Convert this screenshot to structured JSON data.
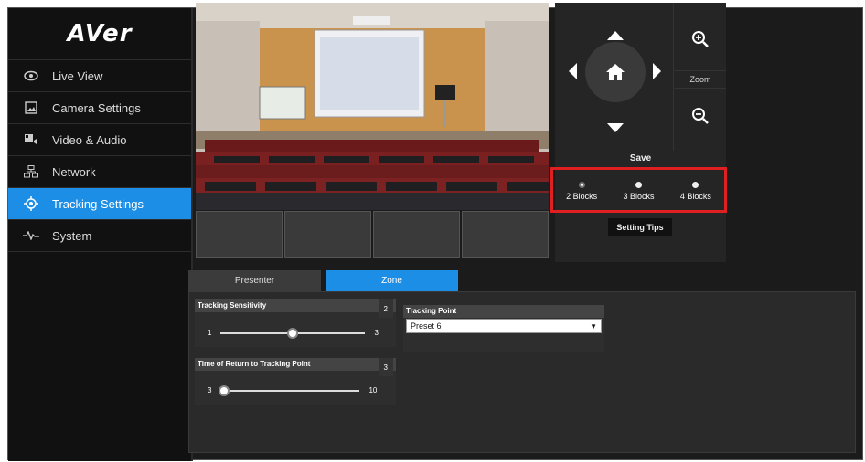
{
  "brand": {
    "logo_text": "AVer"
  },
  "sidebar": {
    "items": [
      {
        "label": "Live View",
        "icon": "eye-icon",
        "active": false
      },
      {
        "label": "Camera Settings",
        "icon": "image-icon",
        "active": false
      },
      {
        "label": "Video & Audio",
        "icon": "video-audio-icon",
        "active": false
      },
      {
        "label": "Network",
        "icon": "network-icon",
        "active": false
      },
      {
        "label": "Tracking Settings",
        "icon": "target-icon",
        "active": true
      },
      {
        "label": "System",
        "icon": "pulse-icon",
        "active": false
      }
    ]
  },
  "ptz": {
    "zoom_label": "Zoom",
    "save_label": "Save",
    "setting_tips_label": "Setting Tips",
    "blocks": [
      {
        "label": "2 Blocks",
        "selected": true
      },
      {
        "label": "3 Blocks",
        "selected": false
      },
      {
        "label": "4 Blocks",
        "selected": false
      }
    ]
  },
  "tabs": [
    {
      "label": "Presenter",
      "active": false
    },
    {
      "label": "Zone",
      "active": true
    }
  ],
  "tracking_sensitivity": {
    "title": "Tracking Sensitivity",
    "value": "2",
    "min": "1",
    "max": "3",
    "level": 2
  },
  "time_of_return": {
    "title": "Time of Return to Tracking Point",
    "value": "3",
    "min": "3",
    "max": "10",
    "level": 3
  },
  "tracking_point": {
    "title": "Tracking Point",
    "selected": "Preset 6"
  },
  "colors": {
    "accent": "#1d8ee6",
    "highlight_border": "#e02020"
  }
}
